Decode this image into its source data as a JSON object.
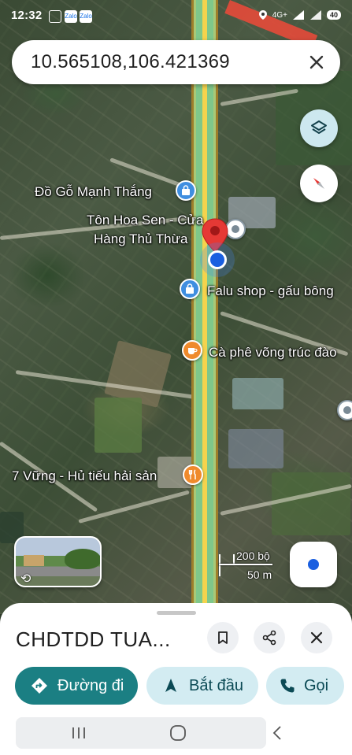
{
  "status_bar": {
    "time": "12:32",
    "network": "4G+",
    "battery": "40",
    "apps": [
      "Zalo",
      "Zalo"
    ]
  },
  "search": {
    "query": "10.565108,106.421369",
    "clear_icon": "close-icon"
  },
  "map": {
    "labels": {
      "poi_1": "Đồ Gỗ Mạnh Thắng",
      "poi_2_line1": "Tôn Hoa Sen - Cửa",
      "poi_2_line2": "Hàng Thủ Thừa",
      "poi_3": "Falu shop - gấu bông",
      "poi_4": "Cà phê võng trúc đào",
      "poi_5": "7 Vững - Hủ tiếu hải sản"
    },
    "scale": {
      "top": "200 bộ",
      "bottom": "50 m"
    },
    "colors": {
      "main_road_center": "#f5d34d",
      "main_road_edge": "#7fc78a",
      "pin": "#e53935",
      "my_location": "#1a5fe0"
    }
  },
  "sheet": {
    "title": "CHDTDD TUA...",
    "save_icon": "bookmark-icon",
    "share_icon": "share-icon",
    "close_icon": "close-icon",
    "buttons": {
      "directions": "Đường đi",
      "start": "Bắt đầu",
      "call": "Gọi"
    },
    "colors": {
      "primary": "#1b7f83",
      "secondary": "#d3ecf2"
    }
  },
  "nav_bar": {
    "recents": "recents-icon",
    "home": "home-icon",
    "back": "back-icon"
  }
}
